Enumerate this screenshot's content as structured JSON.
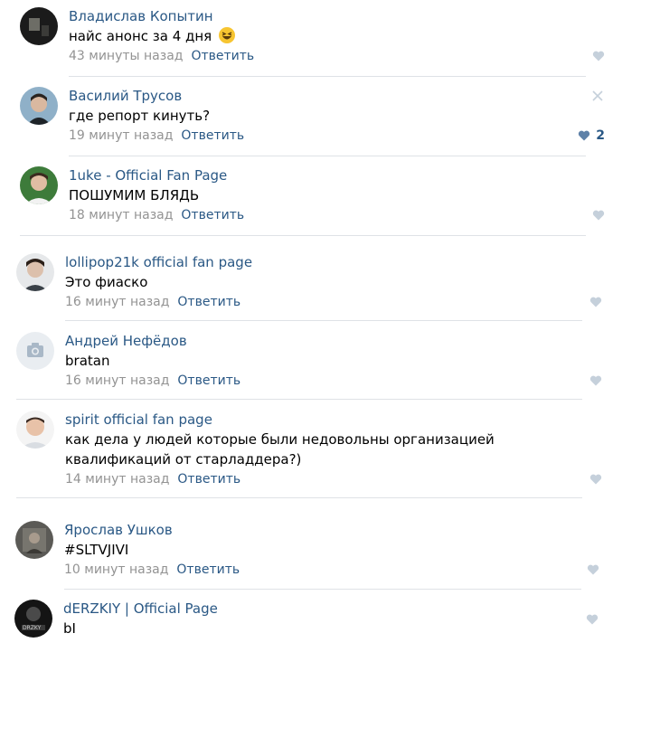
{
  "comments": [
    {
      "author": "Владислав Копытин",
      "text": "найс анонс за 4 дня",
      "emoji": "laughing-emoji",
      "time": "43 минуты назад",
      "reply": "Ответить",
      "likes": "",
      "liked": false
    },
    {
      "author": "Василий Трусов",
      "text": "где репорт кинуть?",
      "time": "19 минут назад",
      "reply": "Ответить",
      "likes": "2",
      "liked": true,
      "close_icon": "close-icon"
    },
    {
      "author": "1uke - Official Fan Page",
      "text": "ПОШУМИМ БЛЯДЬ",
      "time": "18 минут назад",
      "reply": "Ответить",
      "likes": "",
      "liked": false
    },
    {
      "author": "lollipop21k official fan page",
      "text": "Это фиаско",
      "time": "16 минут назад",
      "reply": "Ответить",
      "likes": "",
      "liked": false
    },
    {
      "author": "Андрей Нефёдов",
      "text": "bratan",
      "time": "16 минут назад",
      "reply": "Ответить",
      "likes": "",
      "liked": false
    },
    {
      "author": "spirit official fan page",
      "text": "как дела у людей которые были недовольны организацией квалификаций от старладдера?)",
      "time": "14 минут назад",
      "reply": "Ответить",
      "likes": "",
      "liked": false
    },
    {
      "author": "Ярослав Ушков",
      "text": "#SLTVJIVI",
      "time": "10 минут назад",
      "reply": "Ответить",
      "likes": "",
      "liked": false
    },
    {
      "author": "dERZKIY | Official Page",
      "text": "bI",
      "time": "",
      "reply": "",
      "likes": "",
      "liked": false
    }
  ],
  "colors": {
    "link": "#2a5885",
    "meta": "#939393",
    "divider": "#dfe2e6",
    "like_idle": "#c5d0db",
    "like_active": "#5e81a8"
  }
}
